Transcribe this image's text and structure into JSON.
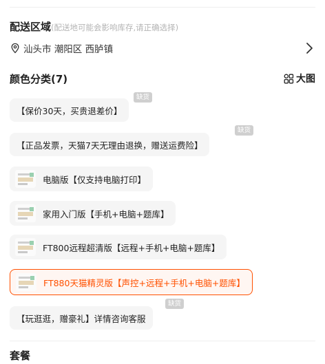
{
  "shipping": {
    "title": "配送区域",
    "hint": "(配送地可能会影响库存,请正确选择)",
    "address": "汕头市 潮阳区 西胪镇"
  },
  "color_section": {
    "title": "颜色分类(7)",
    "big_pic_label": "大图",
    "options": [
      {
        "label": "【保价30天，买贵退差价】",
        "has_thumb": false,
        "badge": "缺货",
        "selected": false
      },
      {
        "label": "【正品发票，天猫7天无理由退换，赠送运费险】",
        "has_thumb": false,
        "badge": "缺货",
        "selected": false
      },
      {
        "label": "电脑版【仅支持电脑打印】",
        "has_thumb": true,
        "badge": "",
        "selected": false
      },
      {
        "label": "家用入门版【手机+电脑+题库】",
        "has_thumb": true,
        "badge": "",
        "selected": false
      },
      {
        "label": "FT800远程超清版【远程+手机+电脑+题库】",
        "has_thumb": true,
        "badge": "",
        "selected": false
      },
      {
        "label": "FT880天猫精灵版【声控+远程+手机+电脑+题库】",
        "has_thumb": true,
        "badge": "",
        "selected": true
      },
      {
        "label": "【玩逛逛，赠豪礼】详情咨询客服",
        "has_thumb": false,
        "badge": "缺货",
        "selected": false
      }
    ]
  },
  "package": {
    "title": "套餐"
  },
  "colors": {
    "accent": "#ff5000",
    "badge_bg": "#cfcfcf",
    "option_bg": "#f5f5f5",
    "hint": "#b4b4b4"
  },
  "icons": {
    "location": "location-pin-icon",
    "chevron": "chevron-right-icon",
    "grid": "grid-icon"
  }
}
